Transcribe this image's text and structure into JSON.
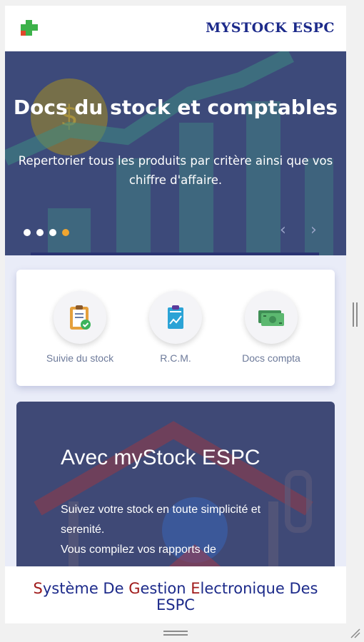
{
  "header": {
    "brand": "MYSTOCK ESPC",
    "logo_icon": "green-puzzle-icon"
  },
  "hero": {
    "title": "Docs du stock et comptables",
    "subtitle": "Repertorier tous les produits par critère ainsi que vos chiffre d'affaire.",
    "slides_total": 4,
    "active_slide": 4,
    "prev_icon": "chevron-left-icon",
    "next_icon": "chevron-right-icon"
  },
  "menu": {
    "items": [
      {
        "label": "Suivie du stock",
        "icon": "clipboard-check-icon"
      },
      {
        "label": "R.C.M.",
        "icon": "clipboard-chart-icon"
      },
      {
        "label": "Docs compta",
        "icon": "money-bills-icon"
      }
    ]
  },
  "promo": {
    "title": "Avec myStock ESPC",
    "line1": "Suivez votre stock en toute simplicité et",
    "line2": "serenité.",
    "line3": "Vous compilez vos rapports de"
  },
  "footer": {
    "p1": "S",
    "p2": "ystème De ",
    "p3": "G",
    "p4": "estion ",
    "p5": "E",
    "p6": "lectronique Des",
    "p7": "ESPC"
  },
  "colors": {
    "brand": "#1c2a8a",
    "accent": "#f0a630",
    "hero_bg": "#3d4a7a"
  }
}
